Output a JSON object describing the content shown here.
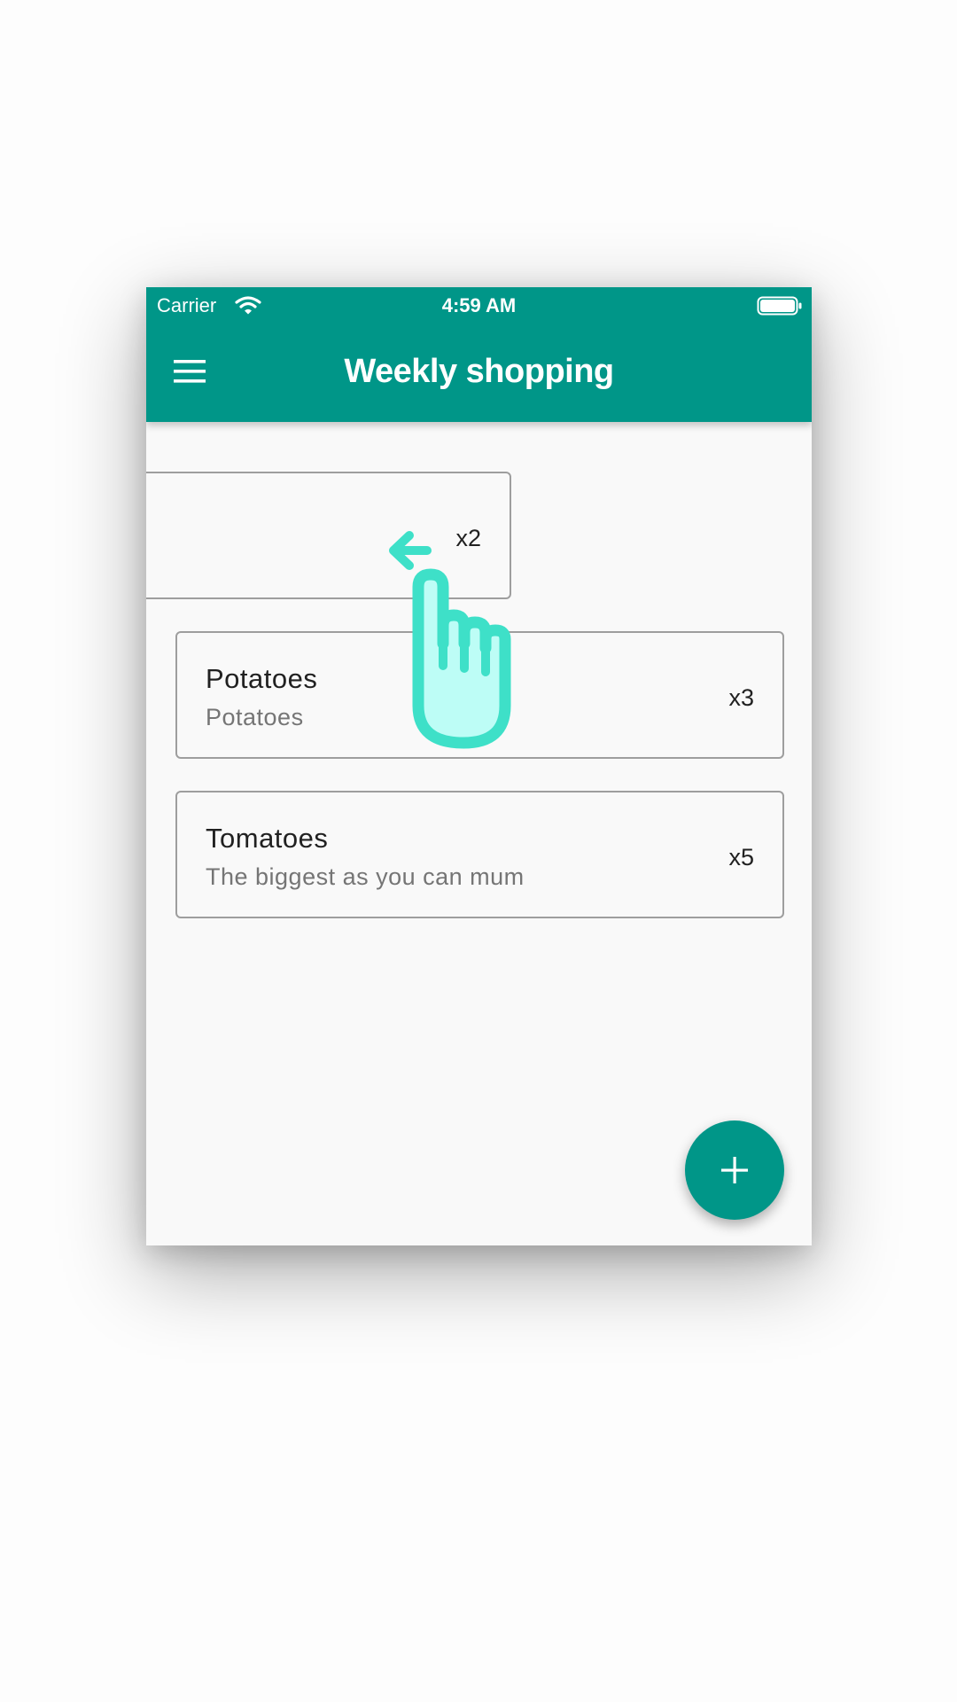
{
  "status_bar": {
    "carrier": "Carrier",
    "time": "4:59 AM",
    "wifi_icon": "wifi-icon",
    "battery_icon": "battery-icon"
  },
  "app_bar": {
    "menu_icon": "menu-icon",
    "title": "Weekly shopping"
  },
  "items": [
    {
      "name": "",
      "note": "",
      "qty": "x2",
      "state": "swiping-left"
    },
    {
      "name": "Potatoes",
      "note": "Potatoes",
      "qty": "x3"
    },
    {
      "name": "Tomatoes",
      "note": "The biggest as you can mum",
      "qty": "x5"
    }
  ],
  "fab": {
    "icon": "plus-icon"
  },
  "overlay": {
    "icon": "swipe-left-hand-icon"
  },
  "colors": {
    "primary": "#009688",
    "background": "#f9f9f9",
    "card_border": "#9e9e9e",
    "hint_stroke": "#3ee0c8",
    "hint_fill": "#bdfdf6"
  }
}
